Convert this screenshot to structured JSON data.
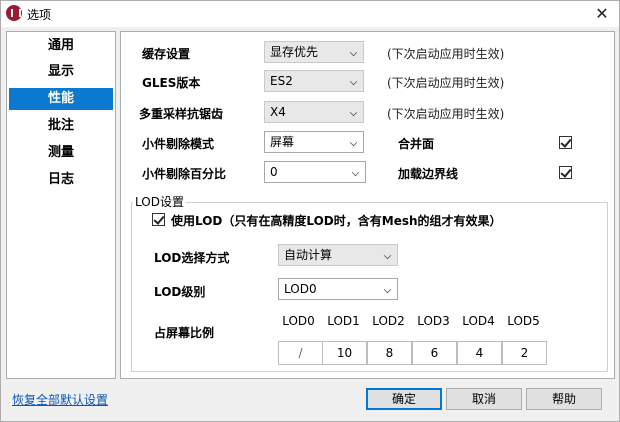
{
  "window": {
    "title": "选项"
  },
  "sidebar": {
    "items": [
      "通用",
      "显示",
      "性能",
      "批注",
      "测量",
      "日志"
    ],
    "active_index": 2
  },
  "performance": {
    "cache": {
      "label": "缓存设置",
      "value": "显存优先",
      "hint": "(下次启动应用时生效)"
    },
    "gles": {
      "label": "GLES版本",
      "value": "ES2",
      "hint": "(下次启动应用时生效)"
    },
    "msaa": {
      "label": "多重采样抗锯齿",
      "value": "X4",
      "hint": "(下次启动应用时生效)"
    },
    "cull_mode": {
      "label": "小件剔除模式",
      "value": "屏幕"
    },
    "merge_faces": {
      "label": "合并面",
      "checked": true
    },
    "cull_percent": {
      "label": "小件剔除百分比",
      "value": "0"
    },
    "load_edges": {
      "label": "加载边界线",
      "checked": true
    }
  },
  "lod": {
    "group_title": "LOD设置",
    "use_lod": {
      "label": "使用LOD（只有在高精度LOD时，含有Mesh的组才有效果）",
      "checked": true
    },
    "select_mode": {
      "label": "LOD选择方式",
      "value": "自动计算"
    },
    "level": {
      "label": "LOD级别",
      "value": "LOD0"
    },
    "ratio": {
      "label": "占屏幕比例",
      "headers": [
        "LOD0",
        "LOD1",
        "LOD2",
        "LOD3",
        "LOD4",
        "LOD5"
      ],
      "values": [
        "/",
        "10",
        "8",
        "6",
        "4",
        "2"
      ]
    }
  },
  "footer": {
    "reset_link": "恢复全部默认设置",
    "ok": "确定",
    "cancel": "取消",
    "help": "帮助"
  }
}
